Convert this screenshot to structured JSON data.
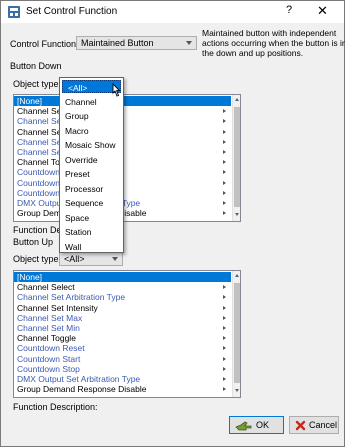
{
  "window": {
    "title": "Set Control Function",
    "help": "?",
    "close": "✕"
  },
  "control_function": {
    "label": "Control Function:",
    "value": "Maintained Button",
    "description": [
      "Maintained button with independent",
      "actions occurring when the button is in",
      "the down and up positions."
    ]
  },
  "button_down": {
    "section_label": "Button Down",
    "object_type_label": "Object type",
    "list_items": [
      {
        "text": "[None]",
        "color": "selected",
        "chevron": false
      },
      {
        "text": "Channel Se",
        "color": "black",
        "chevron": true
      },
      {
        "text": "Channel Se",
        "color": "blue",
        "chevron": true
      },
      {
        "text": "Channel Se",
        "color": "black",
        "chevron": true
      },
      {
        "text": "Channel Se",
        "color": "blue",
        "chevron": true
      },
      {
        "text": "Channel Se",
        "color": "blue",
        "chevron": true
      },
      {
        "text": "Channel To",
        "color": "black",
        "chevron": true
      },
      {
        "text": "Countdown",
        "color": "blue",
        "chevron": true
      },
      {
        "text": "Countdown",
        "color": "blue",
        "chevron": true
      },
      {
        "text": "Countdown",
        "color": "blue",
        "chevron": true
      },
      {
        "text": "DMX Output Set Arbitration Type",
        "color": "blue",
        "chevron": true
      },
      {
        "text": "Group Demand Response Disable",
        "color": "black",
        "chevron": true
      }
    ],
    "function_description_label": "Function Descri"
  },
  "object_type_dropdown": {
    "items": [
      "<All>",
      "Channel",
      "Group",
      "Macro",
      "Mosaic Show",
      "Override",
      "Preset",
      "Processor",
      "Sequence",
      "Space",
      "Station",
      "Wall"
    ]
  },
  "button_up": {
    "section_label": "Button Up",
    "object_type_label": "Object type",
    "object_type_value": "<All>",
    "list_items": [
      {
        "text": "[None]",
        "color": "selected",
        "chevron": false
      },
      {
        "text": "Channel Select",
        "color": "black",
        "chevron": true
      },
      {
        "text": "Channel Set Arbitration Type",
        "color": "blue",
        "chevron": true
      },
      {
        "text": "Channel Set Intensity",
        "color": "black",
        "chevron": true
      },
      {
        "text": "Channel Set Max",
        "color": "blue",
        "chevron": true
      },
      {
        "text": "Channel Set Min",
        "color": "blue",
        "chevron": true
      },
      {
        "text": "Channel Toggle",
        "color": "black",
        "chevron": true
      },
      {
        "text": "Countdown Reset",
        "color": "blue",
        "chevron": true
      },
      {
        "text": "Countdown Start",
        "color": "blue",
        "chevron": true
      },
      {
        "text": "Countdown Stop",
        "color": "blue",
        "chevron": true
      },
      {
        "text": "DMX Output Set Arbitration Type",
        "color": "blue",
        "chevron": true
      },
      {
        "text": "Group Demand Response Disable",
        "color": "black",
        "chevron": true
      }
    ],
    "function_description_label": "Function Description:"
  },
  "buttons": {
    "ok": "OK",
    "cancel": "Cancel"
  },
  "colors": {
    "selection": "#0078d7",
    "blue_text": "#3c5bb0",
    "dialog_bg": "#f0f0f0"
  }
}
